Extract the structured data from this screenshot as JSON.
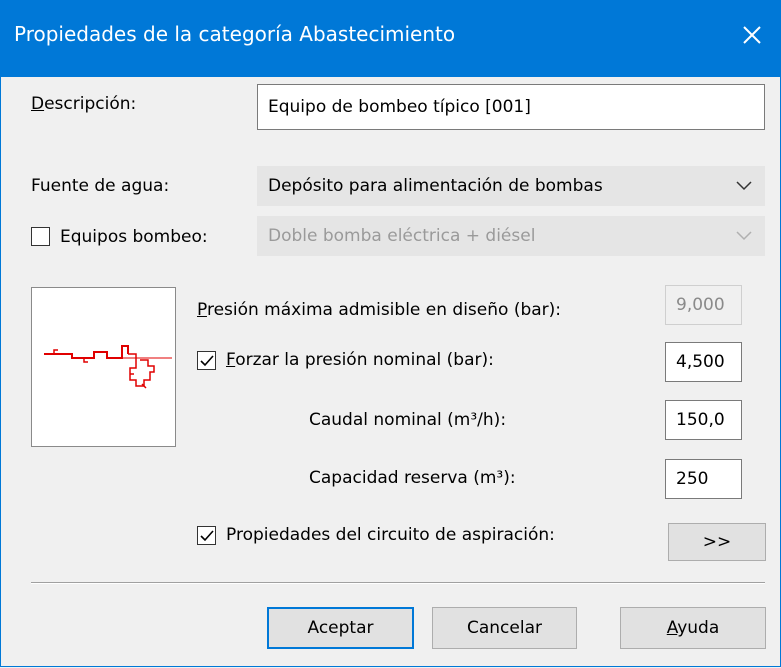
{
  "window": {
    "title": "Propiedades de la categoría Abastecimiento"
  },
  "description": {
    "label": "Descripción:",
    "value": "Equipo de bombeo típico [001]"
  },
  "water_source": {
    "label": "Fuente de agua:",
    "selected": "Depósito para alimentación de bombas"
  },
  "pump_equipment": {
    "label": "Equipos bombeo:",
    "checked": false,
    "selected": "Doble bomba eléctrica + diésel"
  },
  "fields": {
    "max_pressure": {
      "label": "Presión máxima admisible en diseño (bar):",
      "value": "9,000"
    },
    "force_pressure": {
      "label": "Forzar la presión nominal (bar):",
      "checked": true,
      "value": "4,500"
    },
    "nominal_flow": {
      "label": "Caudal nominal (m³/h):",
      "value": "150,0"
    },
    "reserve_capacity": {
      "label": "Capacidad reserva (m³):",
      "value": "250"
    },
    "suction_circuit": {
      "label": "Propiedades del circuito de aspiración:",
      "checked": true,
      "button": ">>"
    }
  },
  "buttons": {
    "accept": "Aceptar",
    "cancel": "Cancelar",
    "help": "Ayuda"
  },
  "colors": {
    "titlebar": "#0078d7",
    "preview_drawing": "#e00000"
  }
}
